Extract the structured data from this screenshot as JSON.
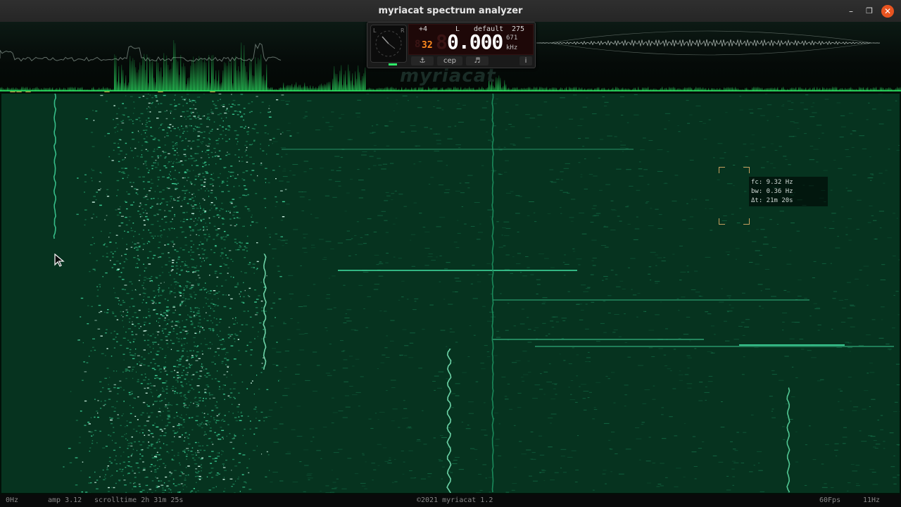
{
  "window": {
    "title": "myriacat spectrum analyzer",
    "controls": [
      "–",
      "❐",
      "✕"
    ]
  },
  "control_panel": {
    "gain": "+4",
    "channel": "L",
    "preset": "default",
    "value_top": "275",
    "value_mid": "671",
    "fft_size": "32",
    "frequency": "0.000",
    "unit": "kHz",
    "buttons": {
      "tune": "⚓",
      "cep": "cep",
      "note": "♬",
      "info": "i"
    }
  },
  "watermark": "myriacat",
  "info_overlay": {
    "fc": "fc: 9.32 Hz",
    "bw": "bw: 0.36 Hz",
    "dt": "Δt: 21m 20s"
  },
  "status": {
    "low_freq": "0Hz",
    "amp": "amp 3.12",
    "scrolltime": "scrolltime 2h 31m 25s",
    "copyright": "©2021 myriacat 1.2",
    "fps": "60Fps",
    "high_freq": "11Hz"
  },
  "colors": {
    "accent_green": "#2ff16a",
    "marker_orange": "#d9a441",
    "close_button": "#e95420",
    "lcd_digits": "#ff8a1e"
  }
}
